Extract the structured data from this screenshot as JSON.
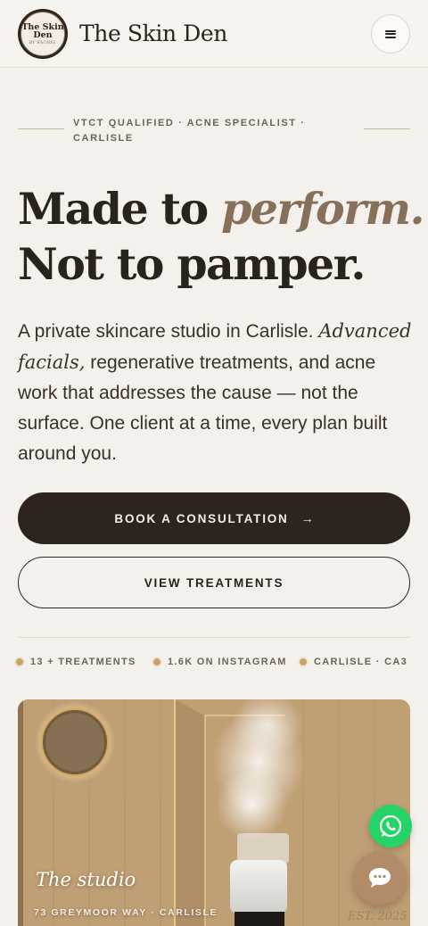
{
  "header": {
    "logo_line1": "The Skin",
    "logo_line2": "Den",
    "logo_line3": "BY RACHEL",
    "brand": "The Skin Den",
    "menu_icon": "hamburger-icon"
  },
  "hero": {
    "eyebrow_line1": "VTCT QUALIFIED · ACNE SPECIALIST ·",
    "eyebrow_line2": "CARLISLE",
    "headline_part1": "Made to ",
    "headline_accent": "perform.",
    "headline_line2": "Not to pamper.",
    "lead_part1": "A private skincare studio in Carlisle. ",
    "lead_em": "Advanced facials,",
    "lead_part2": " regenerative treatments, and acne work that addresses the cause — not the surface. One client at a time, every plan built around you."
  },
  "ctas": {
    "primary_label": "BOOK A CONSULTATION",
    "primary_arrow": "→",
    "secondary_label": "VIEW TREATMENTS"
  },
  "stats": [
    {
      "label": "13  + TREATMENTS"
    },
    {
      "label": "1.6K ON INSTAGRAM"
    },
    {
      "label": "CARLISLE · CA3"
    }
  ],
  "studio": {
    "title": "The studio",
    "address": "73 GREYMOOR WAY · CARLISLE",
    "year": "EST. 2025"
  },
  "floating": {
    "whatsapp_icon": "whatsapp-icon",
    "chat_icon": "chat-bubble-icon"
  },
  "colors": {
    "background": "#f4f1ec",
    "ink": "#2a221c",
    "accent": "#86705a",
    "primary_button": "#2c241d",
    "whatsapp": "#25d366",
    "chat": "#b28c68"
  }
}
